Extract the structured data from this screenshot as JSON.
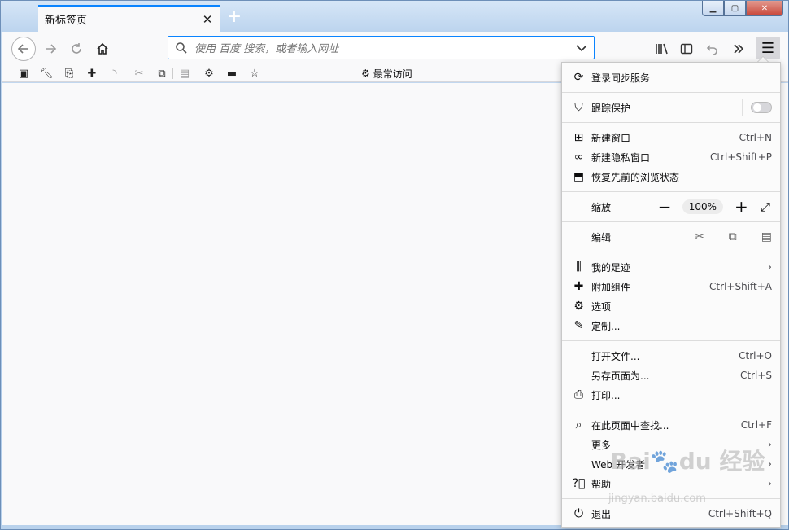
{
  "tab": {
    "title": "新标签页",
    "close": "✕",
    "new_tab": "+"
  },
  "window": {
    "min": "▭",
    "max": "▢",
    "close": "✕"
  },
  "nav": {
    "url_placeholder": "使用 百度 搜索，或者输入网址"
  },
  "bookmarks": {
    "folder_label": "最常访问"
  },
  "menu": {
    "sync": "登录同步服务",
    "tracking": "跟踪保护",
    "new_window": {
      "label": "新建窗口",
      "key": "Ctrl+N"
    },
    "new_private": {
      "label": "新建隐私窗口",
      "key": "Ctrl+Shift+P"
    },
    "restore": "恢复先前的浏览状态",
    "zoom": {
      "label": "缩放",
      "minus": "−",
      "value": "100%",
      "plus": "+"
    },
    "edit": "编辑",
    "library": "我的足迹",
    "addons": {
      "label": "附加组件",
      "key": "Ctrl+Shift+A"
    },
    "options": "选项",
    "customize": "定制...",
    "open_file": {
      "label": "打开文件...",
      "key": "Ctrl+O"
    },
    "save_page": {
      "label": "另存页面为...",
      "key": "Ctrl+S"
    },
    "print": "打印...",
    "find": {
      "label": "在此页面中查找...",
      "key": "Ctrl+F"
    },
    "more": "更多",
    "webdev": "Web 开发者",
    "help": "帮助",
    "quit": {
      "label": "退出",
      "key": "Ctrl+Shift+Q"
    }
  },
  "watermark": {
    "main": "Bai🐾du 经验",
    "sub": "jingyan.baidu.com"
  }
}
